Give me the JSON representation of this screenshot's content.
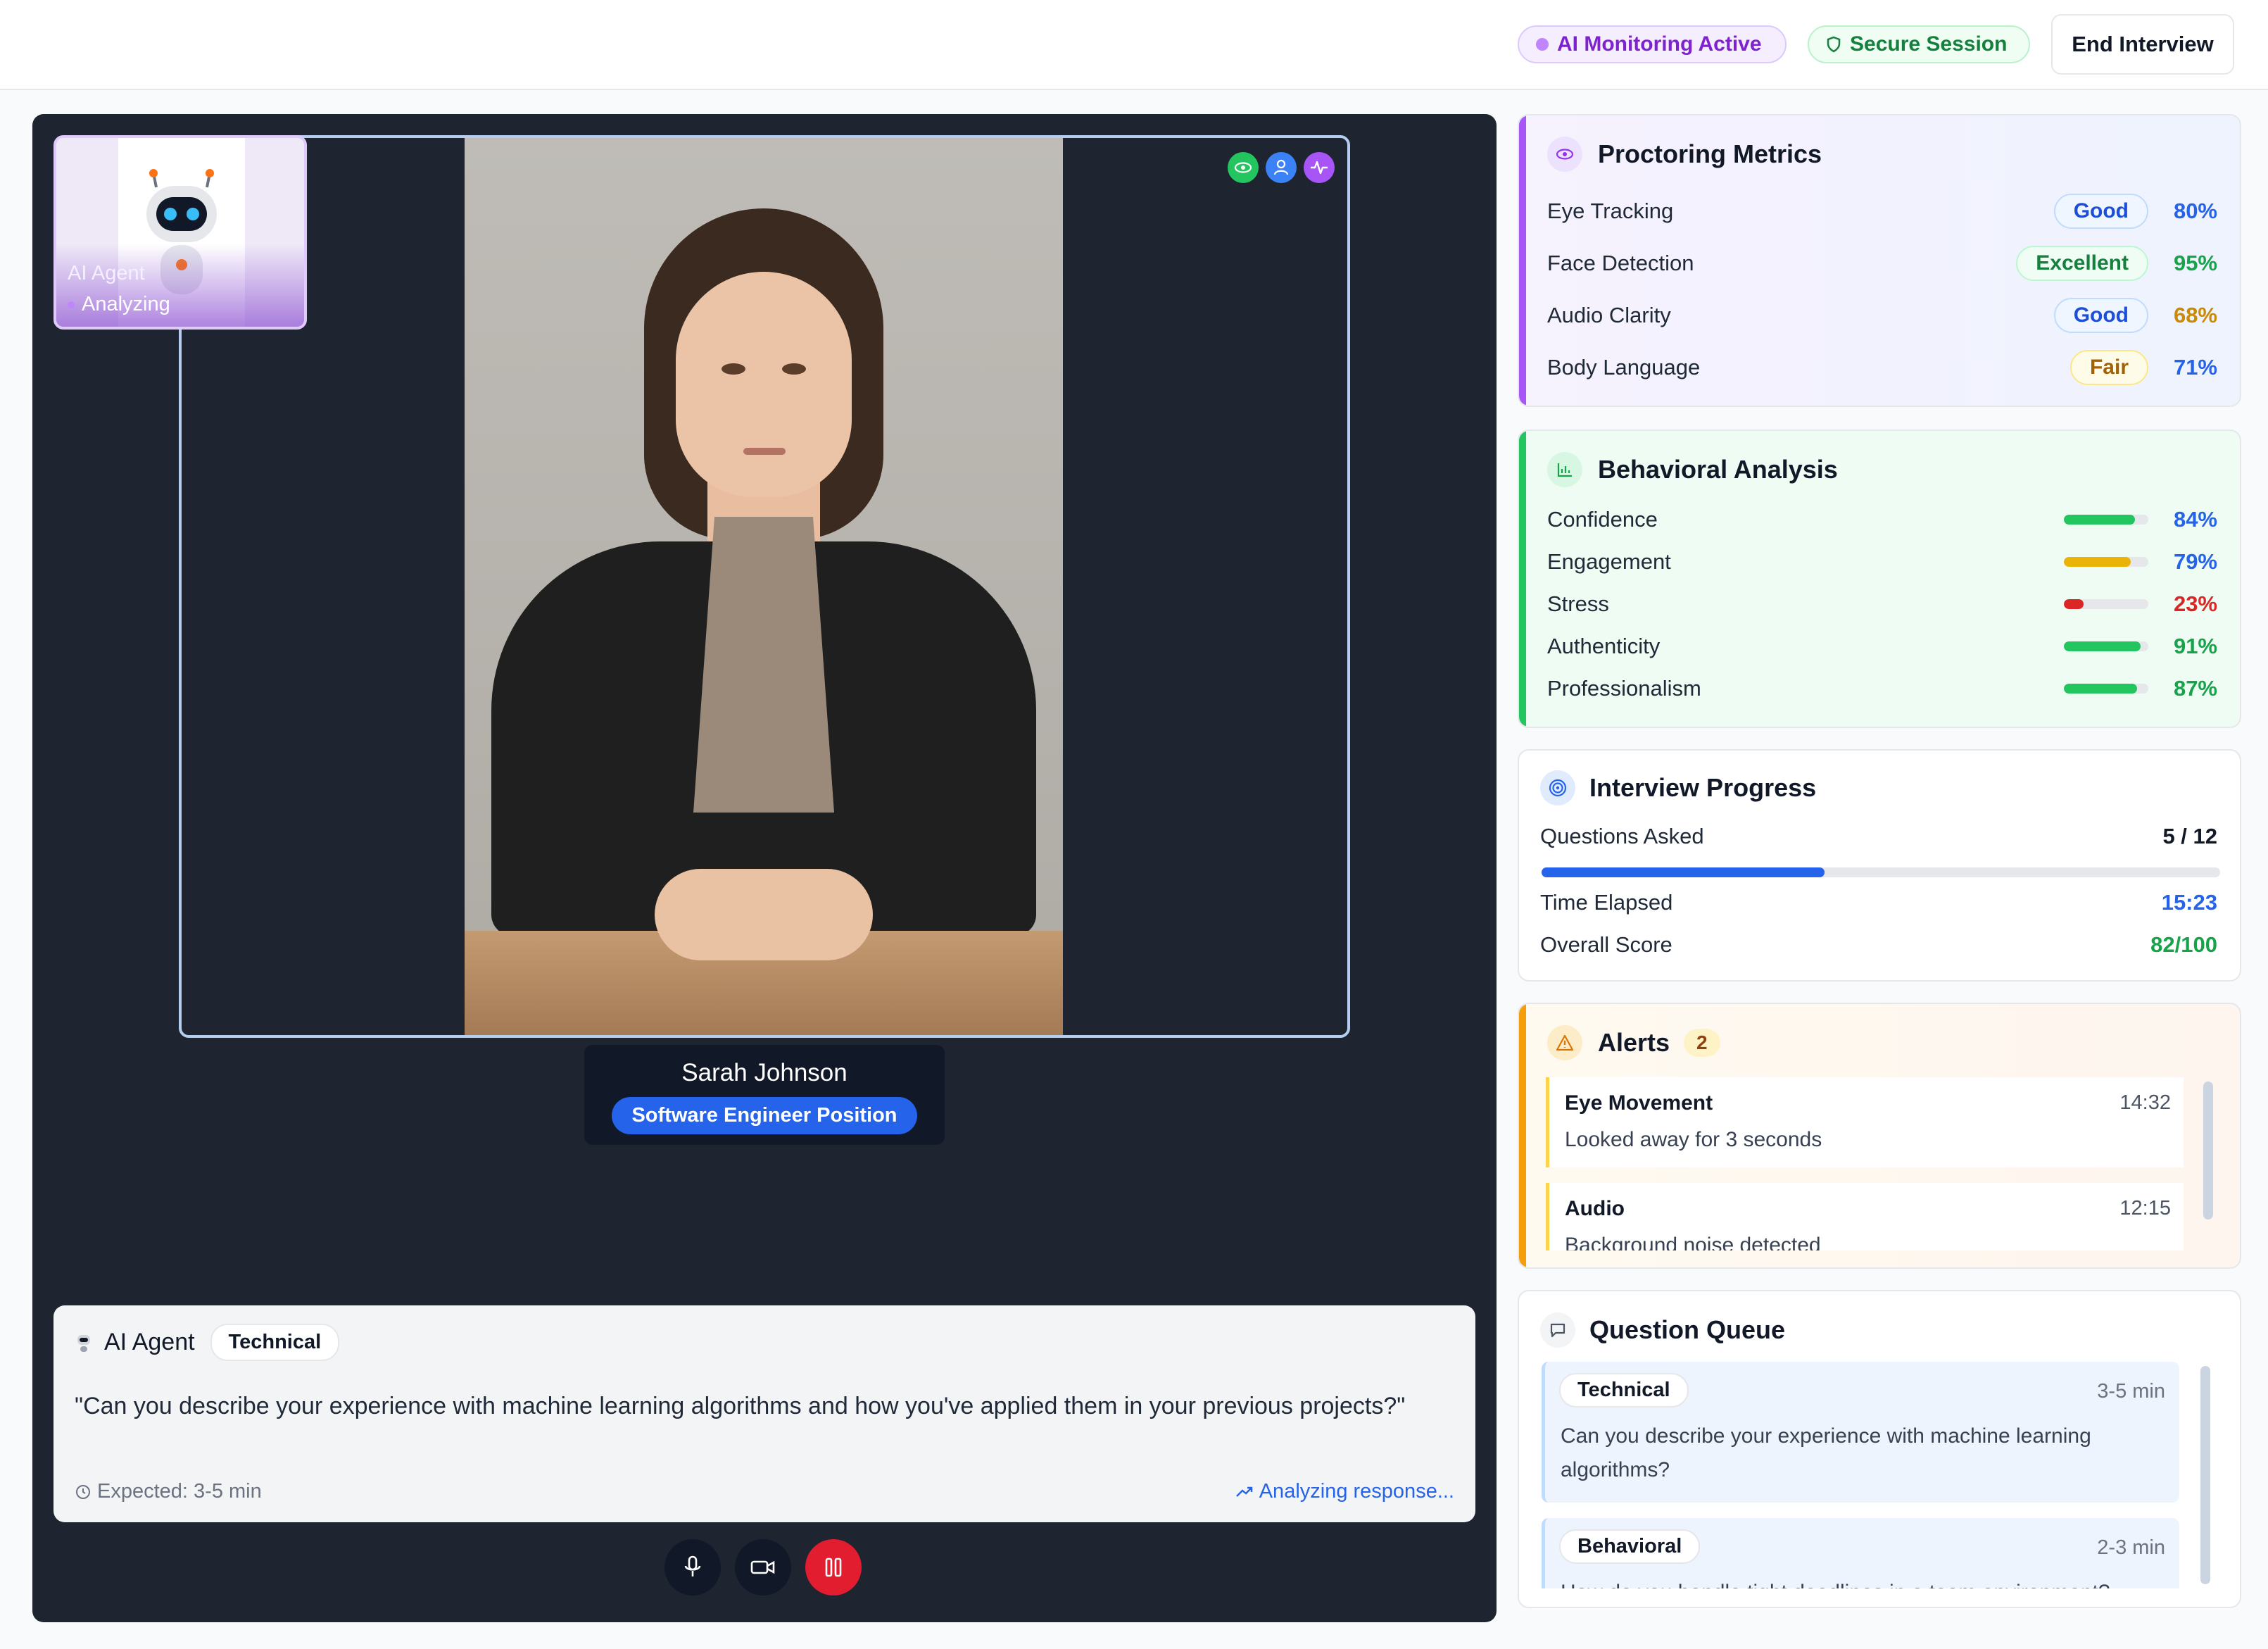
{
  "header": {
    "monitoring_label": "AI Monitoring Active",
    "secure_label": "Secure Session",
    "end_button": "End Interview"
  },
  "video": {
    "ai_agent": {
      "name": "AI Agent",
      "status": "Analyzing"
    },
    "candidate": {
      "name": "Sarah Johnson",
      "position": "Software Engineer Position"
    },
    "status_icons": [
      "eye-icon",
      "user-icon",
      "activity-icon"
    ]
  },
  "question": {
    "agent_label": "AI Agent",
    "tag": "Technical",
    "text": "\"Can you describe your experience with machine learning algorithms and how you've applied them in your previous projects?\"",
    "expected": "Expected: 3-5 min",
    "analyzing": "Analyzing response..."
  },
  "controls": [
    "microphone-icon",
    "camera-icon",
    "pause-icon"
  ],
  "proctoring": {
    "title": "Proctoring Metrics",
    "items": [
      {
        "label": "Eye Tracking",
        "badge": "Good",
        "value": "80%",
        "color": "#2563eb"
      },
      {
        "label": "Face Detection",
        "badge": "Excellent",
        "value": "95%",
        "color": "#16a34a"
      },
      {
        "label": "Audio Clarity",
        "badge": "Good",
        "value": "68%",
        "color": "#ca8a04"
      },
      {
        "label": "Body Language",
        "badge": "Fair",
        "value": "71%",
        "color": "#2563eb"
      }
    ]
  },
  "behavioral": {
    "title": "Behavioral Analysis",
    "items": [
      {
        "label": "Confidence",
        "value": "84%",
        "fraction": 0.84,
        "bar_color": "#22c55e",
        "text_color": "#2563eb"
      },
      {
        "label": "Engagement",
        "value": "79%",
        "fraction": 0.79,
        "bar_color": "#eab308",
        "text_color": "#2563eb"
      },
      {
        "label": "Stress",
        "value": "23%",
        "fraction": 0.23,
        "bar_color": "#dc2626",
        "text_color": "#dc2626"
      },
      {
        "label": "Authenticity",
        "value": "91%",
        "fraction": 0.91,
        "bar_color": "#22c55e",
        "text_color": "#16a34a"
      },
      {
        "label": "Professionalism",
        "value": "87%",
        "fraction": 0.87,
        "bar_color": "#22c55e",
        "text_color": "#16a34a"
      }
    ]
  },
  "progress": {
    "title": "Interview Progress",
    "questions_label": "Questions Asked",
    "questions_value": "5 / 12",
    "questions_fraction": 0.4167,
    "time_label": "Time Elapsed",
    "time_value": "15:23",
    "score_label": "Overall Score",
    "score_value": "82/100"
  },
  "alerts": {
    "title": "Alerts",
    "count": "2",
    "items": [
      {
        "title": "Eye Movement",
        "time": "14:32",
        "desc": "Looked away for 3 seconds"
      },
      {
        "title": "Audio",
        "time": "12:15",
        "desc": "Background noise detected"
      }
    ]
  },
  "queue": {
    "title": "Question Queue",
    "items": [
      {
        "tag": "Technical",
        "time": "3-5 min",
        "text": "Can you describe your experience with machine learning algorithms?"
      },
      {
        "tag": "Behavioral",
        "time": "2-3 min",
        "text": "How do you handle tight deadlines in a team environment?"
      }
    ]
  }
}
